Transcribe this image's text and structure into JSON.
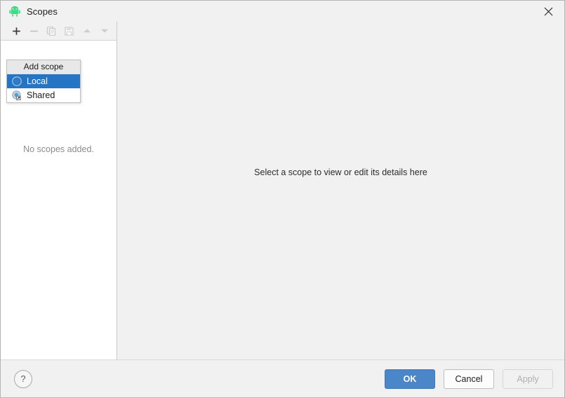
{
  "window": {
    "title": "Scopes",
    "app_icon": "android-robot-icon",
    "close_icon": "close-icon"
  },
  "toolbar": {
    "buttons": [
      {
        "name": "add-scope-button",
        "icon": "plus-icon",
        "enabled": true
      },
      {
        "name": "remove-scope-button",
        "icon": "minus-icon",
        "enabled": false
      },
      {
        "name": "duplicate-scope-button",
        "icon": "copy-icon",
        "enabled": false
      },
      {
        "name": "save-scope-button",
        "icon": "save-icon",
        "enabled": false
      },
      {
        "name": "move-up-button",
        "icon": "chevron-up-icon",
        "enabled": false
      },
      {
        "name": "move-down-button",
        "icon": "chevron-down-icon",
        "enabled": false
      }
    ]
  },
  "popup": {
    "header": "Add scope",
    "items": [
      {
        "label": "Local",
        "icon": "local-scope-icon",
        "selected": true
      },
      {
        "label": "Shared",
        "icon": "shared-scope-icon",
        "selected": false
      }
    ]
  },
  "left_pane": {
    "empty_message": "No scopes added."
  },
  "right_pane": {
    "hint": "Select a scope to view or edit its details here"
  },
  "footer": {
    "help_label": "?",
    "ok_label": "OK",
    "cancel_label": "Cancel",
    "apply_label": "Apply"
  },
  "colors": {
    "selection_blue": "#2675c4",
    "primary_button_blue": "#4a86c8",
    "dialog_background": "#f1f1f1",
    "list_background": "#ffffff",
    "android_green": "#3ddc84"
  }
}
